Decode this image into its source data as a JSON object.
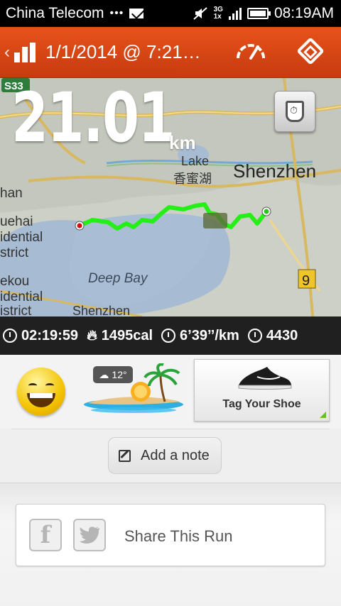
{
  "status_bar": {
    "carrier": "China Telecom",
    "dots": "•••",
    "network": "3G",
    "network2": "1x",
    "time": "08:19AM"
  },
  "header": {
    "title": "1/1/2014 @ 7:21…",
    "brand_color": "#e0491a"
  },
  "map": {
    "labels": [
      "S33",
      "Shenzhen",
      "Lake",
      "香蜜湖",
      "Deep Bay",
      "Shenzhen",
      "han",
      "uehai",
      "idential",
      "strict",
      "ekou",
      "idential",
      "istrict",
      "9"
    ],
    "route_color": "#22ee11"
  },
  "run": {
    "distance": "21.01",
    "unit": "km"
  },
  "stats": {
    "duration": "02:19:59",
    "calories": "1495cal",
    "pace": "6’39’’/km",
    "elevation": "4430"
  },
  "weather": {
    "temperature": "12°"
  },
  "shoe": {
    "label": "Tag Your Shoe"
  },
  "note": {
    "label": "Add a note"
  },
  "share": {
    "label": "Share This Run"
  }
}
